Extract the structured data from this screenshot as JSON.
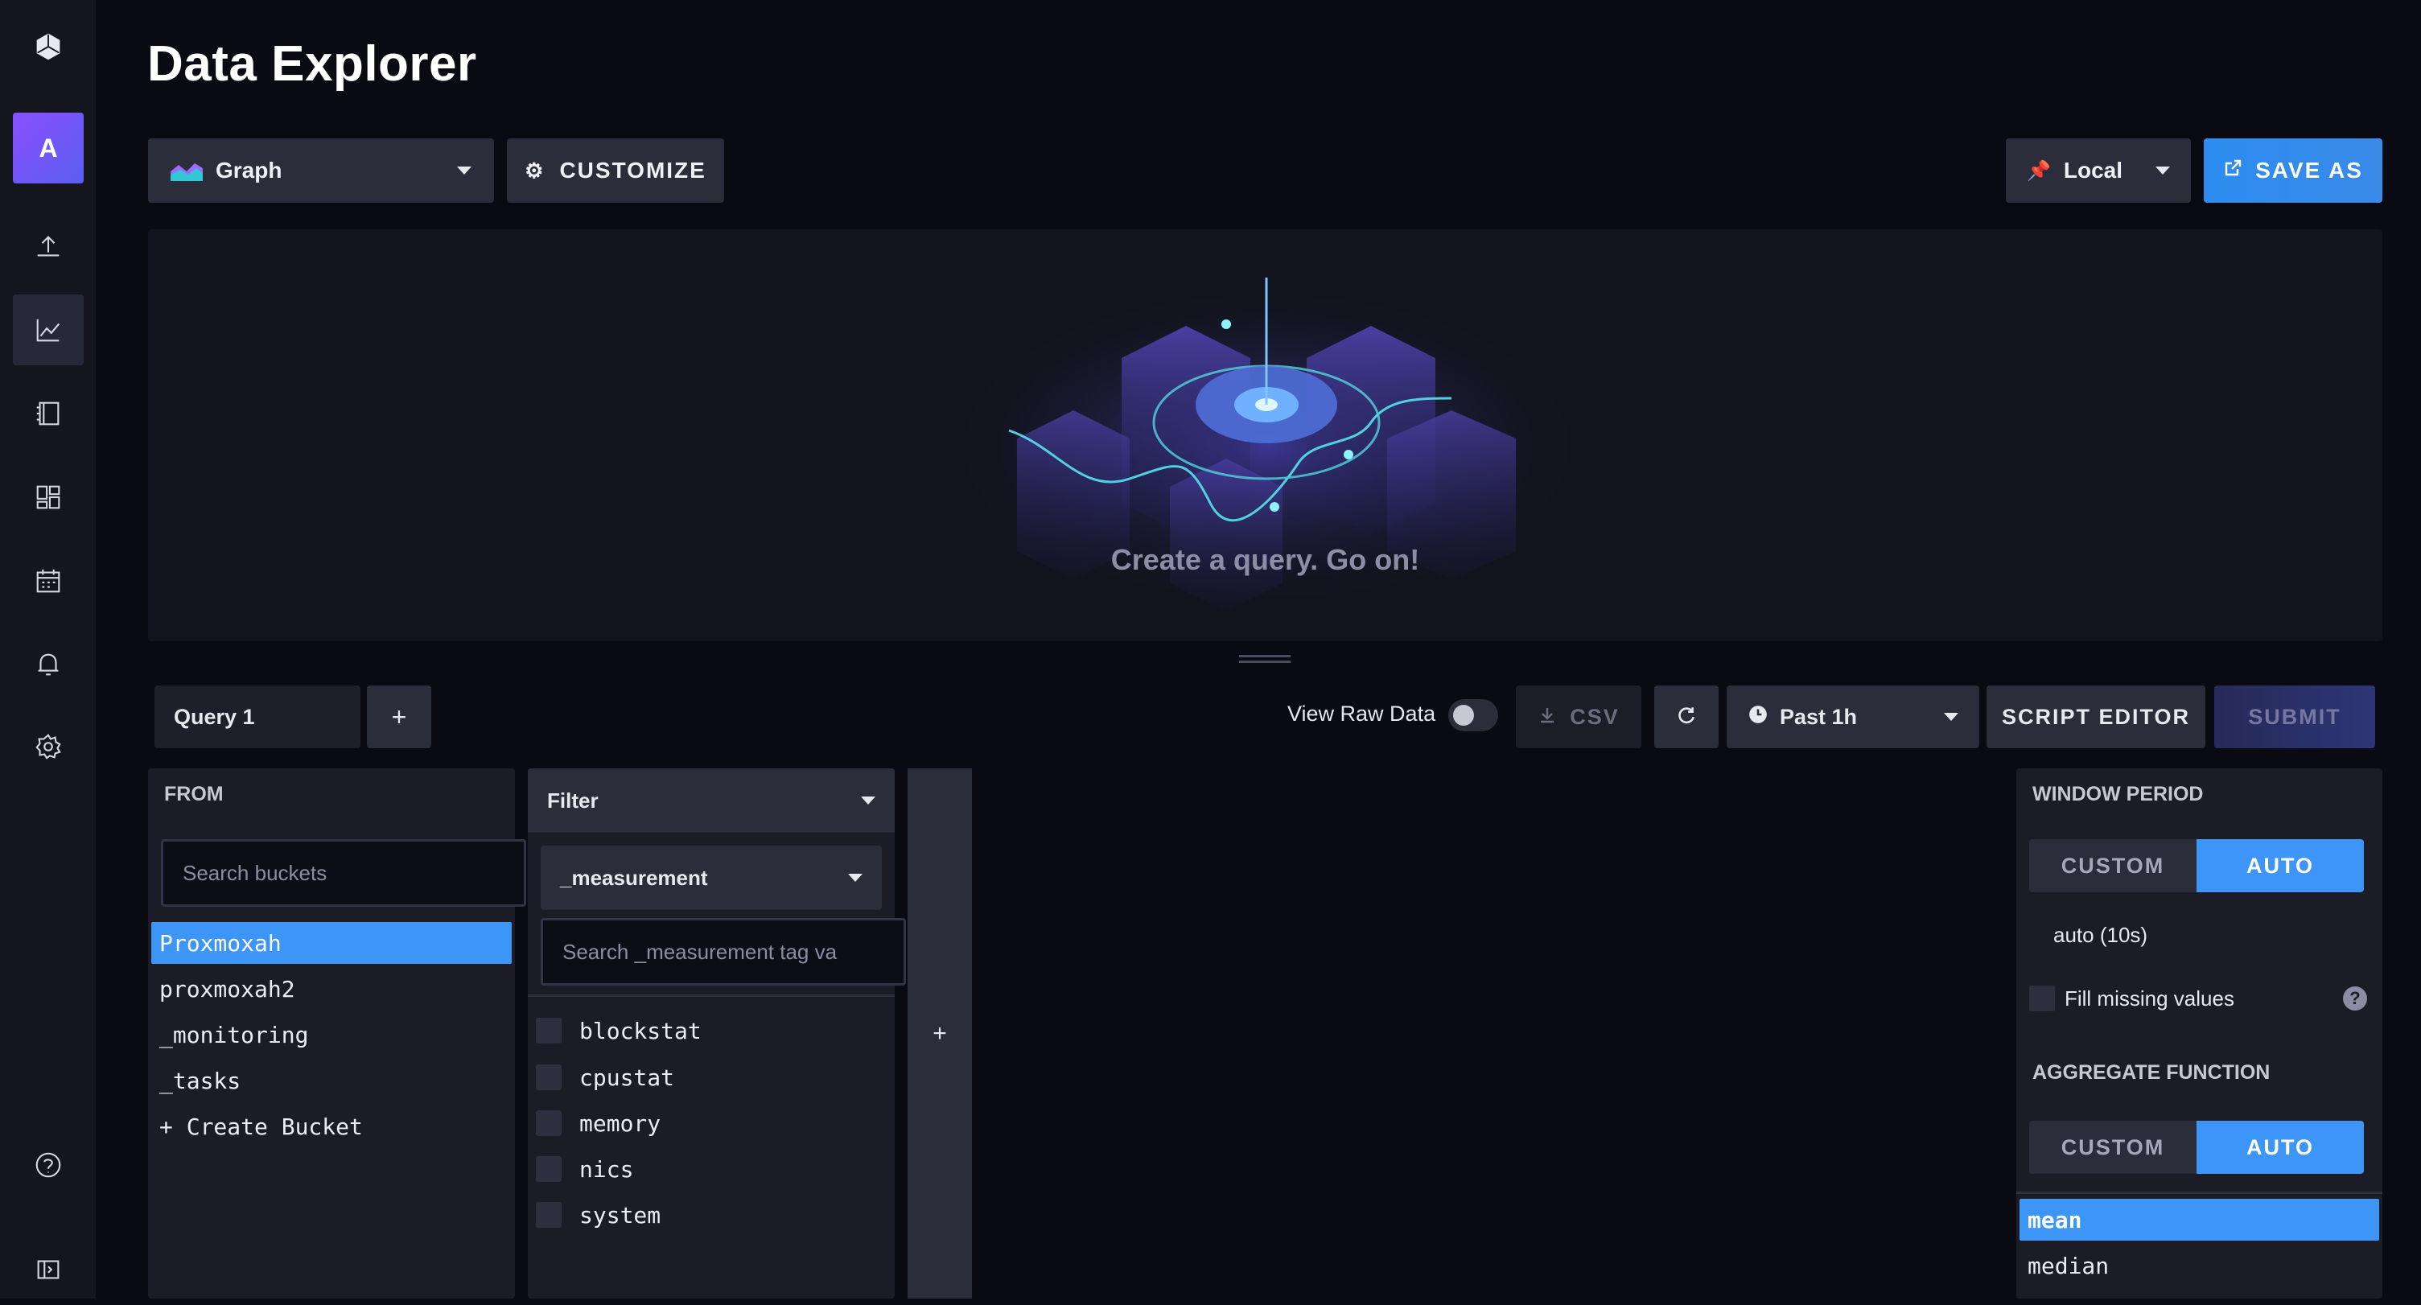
{
  "app": {
    "title": "Data Explorer"
  },
  "sidebar": {
    "avatar_letter": "A",
    "icons": [
      "influx-logo-icon",
      "upload-icon",
      "graph-icon",
      "notebook-icon",
      "dashboard-icon",
      "calendar-icon",
      "bell-icon",
      "gear-icon",
      "help-icon",
      "collapse-icon"
    ]
  },
  "header": {
    "graph_type": "Graph",
    "customize_label": "CUSTOMIZE",
    "timezone": "Local",
    "save_as_label": "SAVE AS"
  },
  "graph": {
    "empty_message": "Create a query. Go on!"
  },
  "query_bar": {
    "tab_label": "Query 1",
    "add_label": "+",
    "raw_data_label": "View Raw Data",
    "raw_data_on": false,
    "csv_label": "CSV",
    "time_range": "Past 1h",
    "script_editor_label": "SCRIPT EDITOR",
    "submit_label": "SUBMIT"
  },
  "from": {
    "title": "FROM",
    "search_placeholder": "Search buckets",
    "buckets": [
      "Proxmoxah",
      "proxmoxah2",
      "_monitoring",
      "_tasks",
      "+ Create Bucket"
    ],
    "selected": "Proxmoxah"
  },
  "filter": {
    "title": "Filter",
    "key": "_measurement",
    "search_placeholder": "Search _measurement tag va",
    "values": [
      "blockstat",
      "cpustat",
      "memory",
      "nics",
      "system"
    ]
  },
  "add_filter": {
    "label": "+"
  },
  "aggregate": {
    "window_title": "WINDOW PERIOD",
    "custom_label": "CUSTOM",
    "auto_label": "AUTO",
    "window_value": "auto (10s)",
    "fill_label": "Fill missing values",
    "function_title": "AGGREGATE FUNCTION",
    "functions": [
      "mean",
      "median"
    ],
    "selected_function": "mean"
  },
  "colors": {
    "accent": "#3e95f8",
    "background": "#0a0a12",
    "panel": "#1b1c26"
  }
}
